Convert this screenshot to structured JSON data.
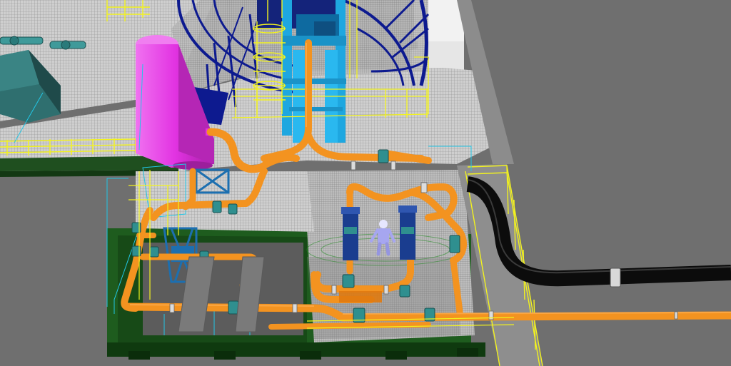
{
  "scene": {
    "colors": {
      "background": "#6e6e6e",
      "deck": "#c9c9c9",
      "deck_grid": "#8a8a8a",
      "platform_green": "#1f5a1f",
      "pipe_orange": "#f39320",
      "pipe_shadow": "#b86a12",
      "pipe_black": "#0d0d0d",
      "vessel_magenta": "#e233e2",
      "structure_blue": "#0d1a8f",
      "tower_cyan": "#1ea7e0",
      "railing_yellow": "#f2f21e",
      "valve_teal": "#2f8f8f",
      "frame_blue": "#1c6fb0",
      "cyan_line": "#22c6e6",
      "white_block": "#f4f4f4"
    }
  }
}
